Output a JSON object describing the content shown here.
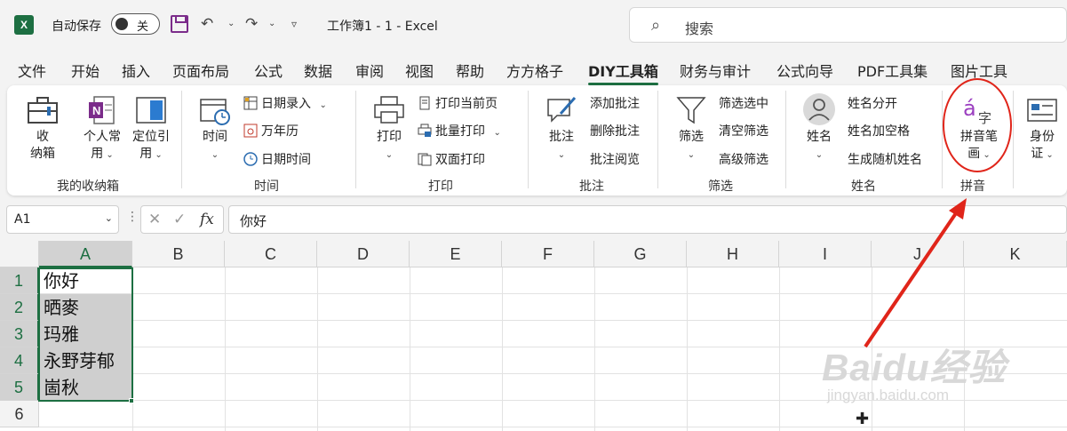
{
  "titlebar": {
    "app_logo": "X",
    "autosave_label": "自动保存",
    "autosave_state": "关",
    "doc_title": "工作簿1  -  1  -  Excel",
    "search_placeholder": "搜索"
  },
  "tabs": [
    "文件",
    "开始",
    "插入",
    "页面布局",
    "公式",
    "数据",
    "审阅",
    "视图",
    "帮助",
    "方方格子",
    "DIY工具箱",
    "财务与审计",
    "公式向导",
    "PDF工具集",
    "图片工具"
  ],
  "active_tab": "DIY工具箱",
  "ribbon": {
    "storage": {
      "label": "我的收纳箱",
      "btn_storage": [
        "收",
        "纳箱"
      ],
      "btn_personal": [
        "个人常",
        "用"
      ],
      "btn_locate": [
        "定位引",
        "用"
      ]
    },
    "time": {
      "label": "时间",
      "btn_time": "时间",
      "date_entry": "日期录入",
      "calendar": "万年历",
      "date_time": "日期时间"
    },
    "print": {
      "label": "打印",
      "btn_print": "打印",
      "print_current": "打印当前页",
      "batch_print": "批量打印",
      "duplex_print": "双面打印"
    },
    "comment": {
      "label": "批注",
      "btn_comment": "批注",
      "add_comment": "添加批注",
      "delete_comment": "删除批注",
      "read_comment": "批注阅览"
    },
    "filter": {
      "label": "筛选",
      "btn_filter": "筛选",
      "filter_selected": "筛选选中",
      "clear_filter": "清空筛选",
      "advanced_filter": "高级筛选"
    },
    "name": {
      "label": "姓名",
      "btn_name": "姓名",
      "split_name": "姓名分开",
      "add_space": "姓名加空格",
      "random_name": "生成随机姓名"
    },
    "pinyin": {
      "label": "拼音",
      "btn_pinyin": [
        "拼音笔",
        "画"
      ]
    },
    "id": {
      "btn_id": [
        "身份",
        "证"
      ]
    }
  },
  "formula_bar": {
    "name_box": "A1",
    "fx_label": "fx",
    "formula": "你好"
  },
  "grid": {
    "columns": [
      "A",
      "B",
      "C",
      "D",
      "E",
      "F",
      "G",
      "H",
      "I",
      "J",
      "K"
    ],
    "rows": [
      "1",
      "2",
      "3",
      "4",
      "5",
      "6"
    ],
    "column_a": [
      "你好",
      "晒麥",
      "玛雅",
      "永野芽郁",
      "崮秋",
      ""
    ]
  },
  "watermark": {
    "main": "Baidu经验",
    "sub": "jingyan.baidu.com"
  },
  "colors": {
    "excel_green": "#1d6f42",
    "annotation_red": "#e0251a",
    "selection_fill": "#cfcfcf"
  }
}
